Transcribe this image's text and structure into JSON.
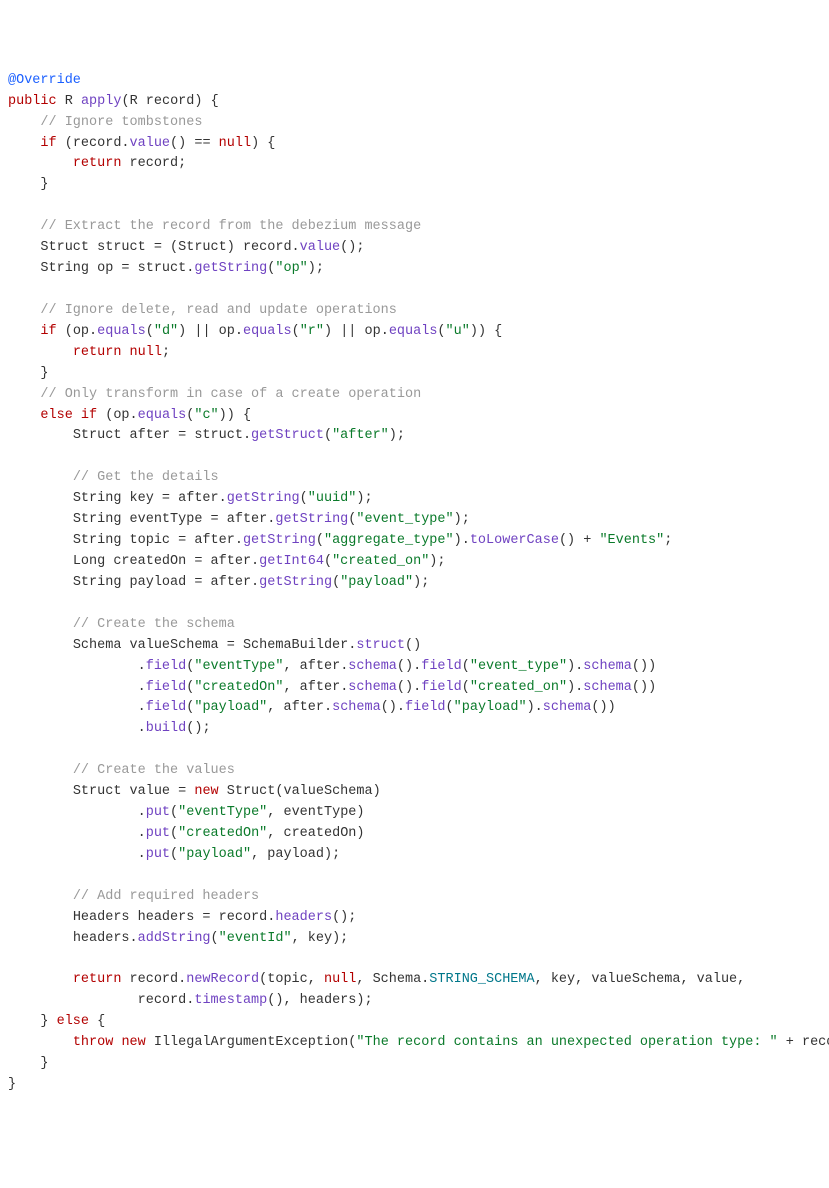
{
  "code": {
    "annotation": "@Override",
    "kw_public": "public",
    "type_R": "R",
    "method_apply": "apply",
    "param_R": "R",
    "param_record": "record",
    "brace_open": "{",
    "brace_close": "}",
    "comment_ignore_tomb": "// Ignore tombstones",
    "kw_if": "if",
    "kw_else": "else",
    "kw_return": "return",
    "kw_null": "null",
    "kw_new": "new",
    "kw_throw": "throw",
    "rec_value_expr": "(record.",
    "value_call": "value",
    "eq_null": "() == ",
    "ret_record": " record;",
    "comment_extract": "// Extract the record from the debezium message",
    "struct_decl": "Struct struct = (Struct) record.",
    "value_call2": "value",
    "end_paren_semi": "();",
    "string_op_decl": "String op = struct.",
    "getString": "getString",
    "op_lit": "\"op\"",
    "close_invoke": ");",
    "comment_ignore_ops": "// Ignore delete, read and update operations",
    "op_expr_open": "(op.",
    "equals_method": "equals",
    "d_lit": "\"d\"",
    "or": ") || op.",
    "r_lit": "\"r\"",
    "u_lit": "\"u\"",
    "close_cond": ")) {",
    "comment_only_transform": "// Only transform in case of a create operation",
    "else_if_open": " (op.",
    "c_lit": "\"c\"",
    "after_decl": "Struct after = struct.",
    "getStruct": "getStruct",
    "after_lit": "\"after\"",
    "comment_get_details": "// Get the details",
    "key_decl": "String key = after.",
    "uuid_lit": "\"uuid\"",
    "eventtype_decl": "String eventType = after.",
    "event_type_lit": "\"event_type\"",
    "topic_decl": "String topic = after.",
    "agg_type_lit": "\"aggregate_type\"",
    "chain_paren": ").",
    "toLowerCase": "toLowerCase",
    "plus_events": "() + ",
    "events_lit": "\"Events\"",
    "semi": ";",
    "createdOn_decl": "Long createdOn = after.",
    "getInt64": "getInt64",
    "created_on_lit": "\"created_on\"",
    "payload_decl": "String payload = after.",
    "payload_lit": "\"payload\"",
    "comment_create_schema": "// Create the schema",
    "schema_decl": "Schema valueSchema = SchemaBuilder.",
    "struct_call": "struct",
    "field_call": "field",
    "eventType_lit2": "\"eventType\"",
    "after_schema": ", after.",
    "schema_method": "schema",
    "dot": "().",
    "field_lit_event_type": "\"event_type\"",
    "close_sch": "())",
    "createdOn_lit2": "\"createdOn\"",
    "created_on_lit2": "\"created_on\"",
    "payload_lit2": "\"payload\"",
    "payload_lit3": "\"payload\"",
    "build_call": "build",
    "comment_create_values": "// Create the values",
    "value_decl": "Struct value = ",
    "struct_ctor": " Struct(valueSchema)",
    "put_call": "put",
    "eventType_lit3": "\"eventType\"",
    "eventType_arg": ", eventType)",
    "createdOn_lit3": "\"createdOn\"",
    "createdOn_arg": ", createdOn)",
    "payload_lit4": "\"payload\"",
    "payload_arg": ", payload);",
    "comment_headers": "// Add required headers",
    "headers_decl": "Headers headers = record.",
    "headers_call": "headers",
    "addString_call": "addString",
    "headers_dot": "headers.",
    "eventId_lit": "\"eventId\"",
    "key_arg": ", key);",
    "return_record": " record.",
    "newRecord": "newRecord",
    "newrec_args1": "(topic, ",
    "newrec_args2": ", Schema.",
    "STRING_SCHEMA": "STRING_SCHEMA",
    "newrec_args3": ", key, valueSchema, value,",
    "newrec_args4": "record.",
    "timestamp": "timestamp",
    "newrec_args5": "(), headers);",
    "throw_line": " IllegalArgumentException(",
    "error_lit": "\"The record contains an unexpected operation type: \"",
    "plus_record": " + record);"
  }
}
